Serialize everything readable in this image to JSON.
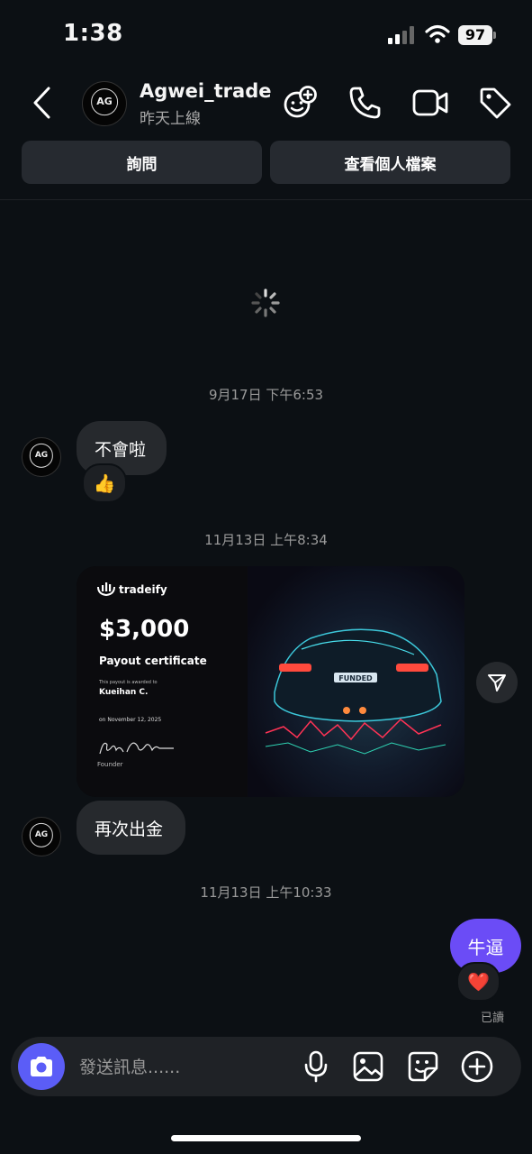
{
  "status_bar": {
    "time": "1:38",
    "battery": "97"
  },
  "header": {
    "username": "Agwei_trade",
    "status": "昨天上線",
    "avatar_text": "AG",
    "buttons": {
      "ask": "詢問",
      "profile": "查看個人檔案"
    }
  },
  "thread": {
    "timestamps": [
      "9月17日 下午6:53",
      "11月13日 上午8:34",
      "11月13日 上午10:33"
    ],
    "msg1": {
      "text": "不會啦",
      "reaction": "👍"
    },
    "certificate": {
      "brand": "tradeify",
      "amount": "$3,000",
      "title": "Payout certificate",
      "awarded_label": "This payout is awarded to",
      "recipient": "Kueihan C.",
      "date": "on November 12, 2025",
      "signature": "Brett Simberloff",
      "founder_label": "Founder",
      "plate": "FUNDED"
    },
    "msg2": {
      "text": "再次出金"
    },
    "msg3": {
      "text": "牛逼",
      "reaction": "❤️"
    },
    "read_receipt": "已讀"
  },
  "composer": {
    "placeholder": "發送訊息......"
  },
  "colors": {
    "background": "#0c1014",
    "bubble_in": "#26292d",
    "bubble_out": "#6b4cf6",
    "camera": "#5b5df7"
  }
}
